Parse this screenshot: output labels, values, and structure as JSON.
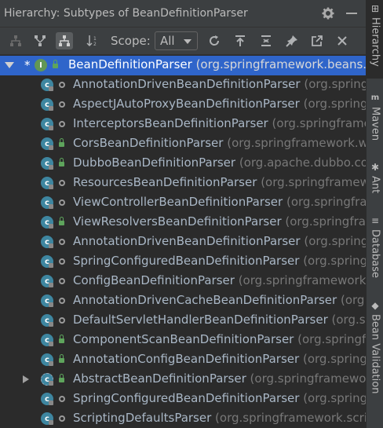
{
  "header": {
    "title": "Hierarchy:",
    "subtitle": "Subtypes of BeanDefinitionParser"
  },
  "toolbar": {
    "scope_label": "Scope:",
    "scope_value": "All"
  },
  "tree": {
    "root": {
      "name": "BeanDefinitionParser",
      "package": "(org.springframework.beans.fa",
      "star": "*",
      "icon_letter": "I"
    },
    "children": [
      {
        "name": "AnnotationDrivenBeanDefinitionParser",
        "package": "(org.springf",
        "modifier": "package"
      },
      {
        "name": "AspectJAutoProxyBeanDefinitionParser",
        "package": "(org.spring",
        "modifier": "package"
      },
      {
        "name": "InterceptorsBeanDefinitionParser",
        "package": "(org.springframew",
        "modifier": "package"
      },
      {
        "name": "CorsBeanDefinitionParser",
        "package": "(org.springframework.we",
        "modifier": "public"
      },
      {
        "name": "DubboBeanDefinitionParser",
        "package": "(org.apache.dubbo.con",
        "modifier": "public"
      },
      {
        "name": "ResourcesBeanDefinitionParser",
        "package": "(org.springframewo",
        "modifier": "package"
      },
      {
        "name": "ViewControllerBeanDefinitionParser",
        "package": "(org.springfra",
        "modifier": "package"
      },
      {
        "name": "ViewResolversBeanDefinitionParser",
        "package": "(org.springfram",
        "modifier": "public"
      },
      {
        "name": "AnnotationDrivenBeanDefinitionParser",
        "package": "(org.springf",
        "modifier": "package"
      },
      {
        "name": "SpringConfiguredBeanDefinitionParser",
        "package": "(org.springf",
        "modifier": "package"
      },
      {
        "name": "ConfigBeanDefinitionParser",
        "package": "(org.springframework.a",
        "modifier": "package"
      },
      {
        "name": "AnnotationDrivenCacheBeanDefinitionParser",
        "package": "(org.sp",
        "modifier": "package"
      },
      {
        "name": "DefaultServletHandlerBeanDefinitionParser",
        "package": "(org.spr",
        "modifier": "package"
      },
      {
        "name": "ComponentScanBeanDefinitionParser",
        "package": "(org.springfra",
        "modifier": "public"
      },
      {
        "name": "AnnotationConfigBeanDefinitionParser",
        "package": "(org.springf",
        "modifier": "public"
      },
      {
        "name": "AbstractBeanDefinitionParser",
        "package": "(org.springframewo",
        "modifier": "public",
        "expandable": true,
        "abstract": true
      },
      {
        "name": "SpringConfiguredBeanDefinitionParser",
        "package": "(org.springf",
        "modifier": "package"
      },
      {
        "name": "ScriptingDefaultsParser",
        "package": "(org.springframework.scrip",
        "modifier": "package"
      }
    ],
    "class_icon_letter": "c"
  },
  "sidebar": {
    "tabs": [
      {
        "label": "Hierarchy",
        "icon": "hierarchy-icon",
        "active": true
      },
      {
        "label": "Maven",
        "icon": "maven-icon",
        "active": false
      },
      {
        "label": "Ant",
        "icon": "ant-icon",
        "active": false
      },
      {
        "label": "Database",
        "icon": "database-icon",
        "active": false
      },
      {
        "label": "Bean Validation",
        "icon": "bean-validation-icon",
        "active": false
      }
    ]
  },
  "colors": {
    "selection": "#2f65ca",
    "class_icon": "#3e86a0",
    "interface_icon": "#629755",
    "package_text": "#787878"
  }
}
